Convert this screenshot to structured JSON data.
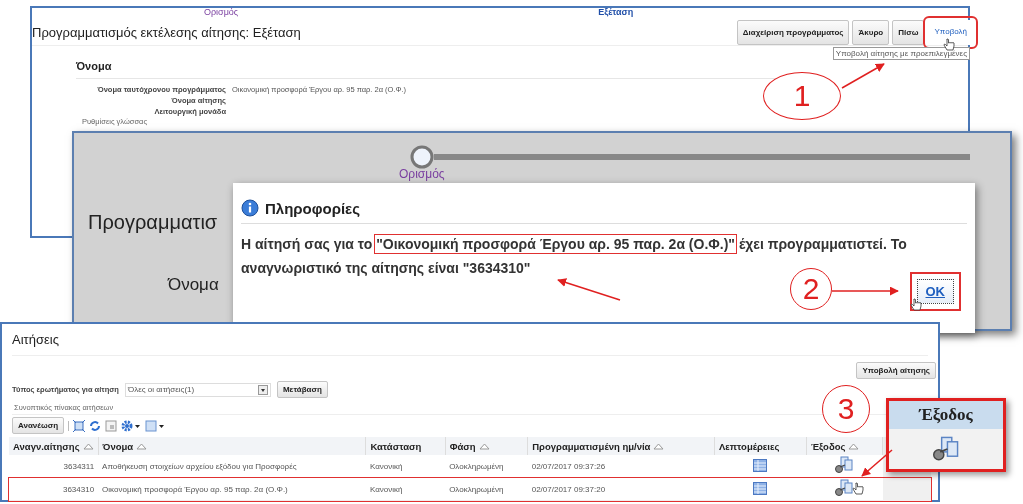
{
  "review_page": {
    "train": [
      {
        "label": "Ορισμός",
        "selected": false
      },
      {
        "label": "Εξέταση",
        "selected": true
      }
    ],
    "title": "Προγραμματισμός εκτέλεσης αίτησης: Εξέταση",
    "buttons": [
      {
        "label": "Διαχείριση προγράμματος",
        "highlighted": false
      },
      {
        "label": "Άκυρο",
        "highlighted": false
      },
      {
        "label": "Πίσω",
        "highlighted": false
      },
      {
        "label": "Υποβολή",
        "highlighted": true
      }
    ],
    "tooltip": "Υποβολή αίτησης με προεπιλεγμένες",
    "section_title": "Όνομα",
    "fields": [
      {
        "label": "Όνομα ταυτόχρονου προγράμματος",
        "value": "Οικονομική προσφορά Έργου αρ. 95 παρ. 2α (Ο.Φ.)"
      },
      {
        "label": "Όνομα αίτησης"
      },
      {
        "label": "Λειτουργική μονάδα"
      }
    ],
    "subsection": "Ρυθμίσεις γλώσσας"
  },
  "background_page": {
    "train_label": "Ορισμός",
    "title": "Προγραμματισ",
    "section_title": "Όνομα"
  },
  "dialog": {
    "title": "Πληροφορίες",
    "message_before": "Η αίτησή σας για το",
    "message_quoted": "\"Οικονομική προσφορά Έργου αρ. 95 παρ. 2α (Ο.Φ.)\"",
    "message_after": "έχει προγραμματιστεί. Το αναγνωριστικό της αίτησης είναι \"3634310\"",
    "button": {
      "label": "OK",
      "highlighted": true
    }
  },
  "requests_page": {
    "title": "Αιτήσεις",
    "submit_button": "Υποβολή αίτησης",
    "query_label": "Τύπος ερωτήματος για αίτηση",
    "query_value": "Όλες οι αιτήσεις(1)",
    "go_button": "Μετάβαση",
    "table_caption": "Συνοπτικός πίνακας αιτήσεων",
    "refresh_button": "Ανανέωση",
    "columns": [
      {
        "label": "Αναγν.αίτησης",
        "sortable": true
      },
      {
        "label": "Όνομα",
        "sortable": true
      },
      {
        "label": "Κατάσταση",
        "sortable": false
      },
      {
        "label": "Φάση",
        "sortable": true
      },
      {
        "label": "Προγραμματισμένη ημ/νία",
        "sortable": true
      },
      {
        "label": "Λεπτομέρειες",
        "sortable": false
      },
      {
        "label": "Έξοδος",
        "sortable": true
      }
    ],
    "rows": [
      {
        "id": "3634311",
        "name": "Αποθήκευση στοιχείων αρχείου εξόδου για Προσφορές",
        "status": "Κανονική",
        "phase": "Ολοκληρωμένη",
        "scheduled": "02/07/2017 09:37:26",
        "highlighted": false
      },
      {
        "id": "3634310",
        "name": "Οικονομική προσφορά Έργου αρ. 95 παρ. 2α (Ο.Φ.)",
        "status": "Κανονική",
        "phase": "Ολοκληρωμένη",
        "scheduled": "02/07/2017 09:37:20",
        "highlighted": true
      }
    ]
  },
  "callouts": [
    "1",
    "2",
    "3"
  ],
  "zoom_inset": {
    "column": "Έξοδος"
  }
}
